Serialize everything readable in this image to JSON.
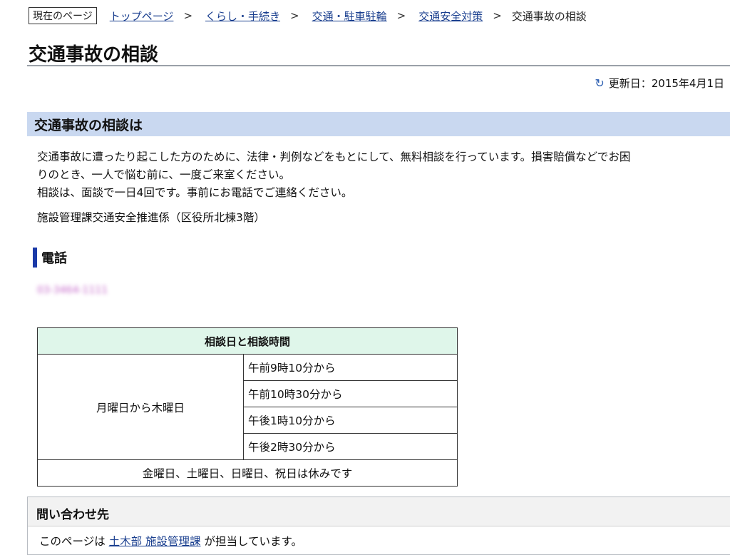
{
  "breadcrumb": {
    "label": "現在のページ",
    "links": [
      "トップページ",
      "くらし・手続き",
      "交通・駐車駐輪",
      "交通安全対策"
    ],
    "separator": ">",
    "current": "交通事故の相談"
  },
  "page_title": "交通事故の相談",
  "updated": {
    "icon": "refresh-icon",
    "text": "更新日：2015年4月1日"
  },
  "section": {
    "title": "交通事故の相談は",
    "paragraph_lines": [
      "交通事故に遭ったり起こした方のために、法律・判例などをもとにして、無料相談を行っています。損害賠償などでお困",
      "りのとき、一人で悩む前に、一度ご来室ください。",
      "相談は、面談で一日4回です。事前にお電話でご連絡ください。"
    ],
    "facility": "施設管理課交通安全推進係（区役所北棟3階）"
  },
  "phone": {
    "heading": "電話",
    "number_blurred": "03-3464-1111"
  },
  "schedule": {
    "header": "相談日と相談時間",
    "days": "月曜日から木曜日",
    "times": [
      "午前9時10分から",
      "午前10時30分から",
      "午後1時10分から",
      "午後2時30分から"
    ],
    "closed": "金曜日、土曜日、日曜日、祝日は休みです"
  },
  "contact": {
    "heading": "問い合わせ先",
    "prefix": "このページは ",
    "link": "土木部 施設管理課",
    "suffix": " が担当しています。"
  },
  "colors": {
    "link": "#1a3f8f",
    "section_bg": "#c9d8f0",
    "table_header_bg": "#dff6ea",
    "accent_bar": "#1b3aa8"
  }
}
